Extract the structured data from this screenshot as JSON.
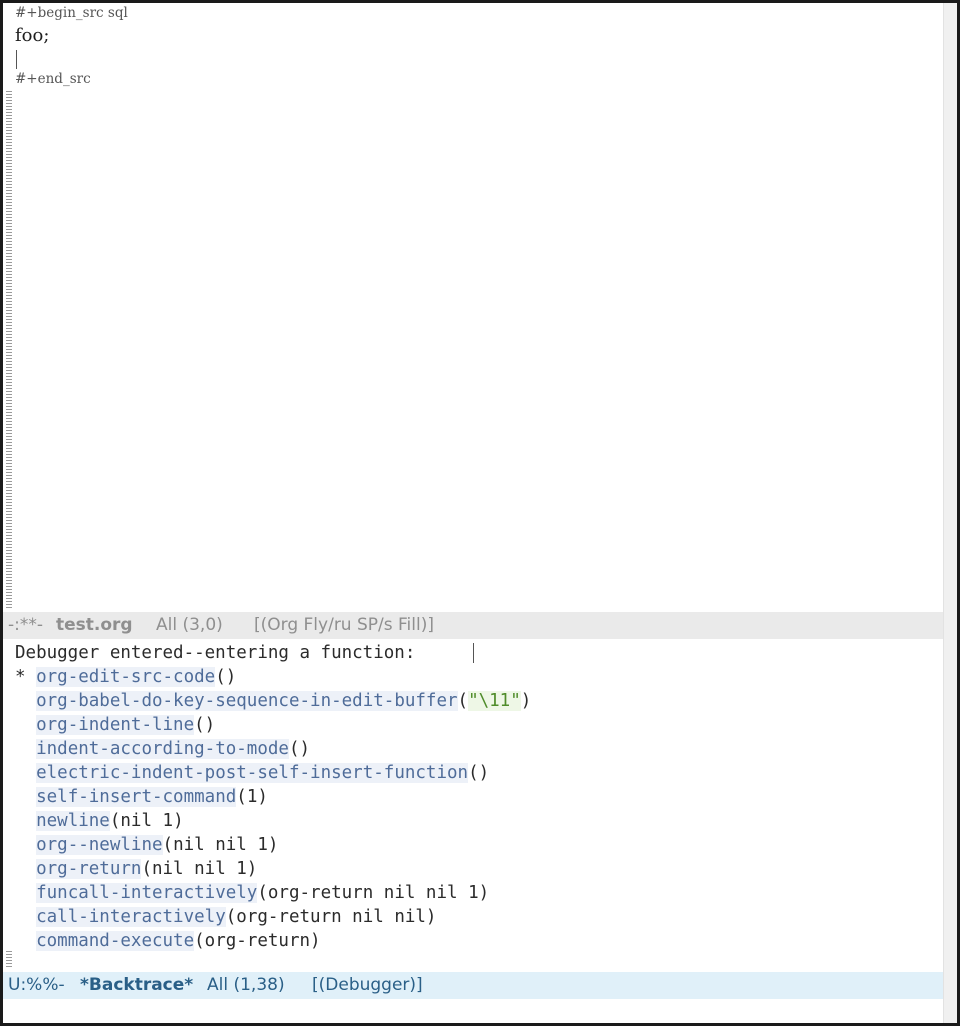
{
  "src_buffer": {
    "begin_line": "#+begin_src sql",
    "code_line": "foo;",
    "end_line": "#+end_src"
  },
  "modeline_top": {
    "status": "-:**-",
    "buffer": "test.org",
    "position": "All (3,0)",
    "modes": "[(Org Fly/ru SP/s Fill)]"
  },
  "debugger": {
    "header": "Debugger entered--entering a function:",
    "frames": [
      {
        "marker": "*",
        "fn": "org-edit-src-code",
        "args_pre": "()",
        "str": "",
        "args_post": ""
      },
      {
        "marker": " ",
        "fn": "org-babel-do-key-sequence-in-edit-buffer",
        "args_pre": "(",
        "str": "\"\\11\"",
        "args_post": ")"
      },
      {
        "marker": " ",
        "fn": "org-indent-line",
        "args_pre": "()",
        "str": "",
        "args_post": ""
      },
      {
        "marker": " ",
        "fn": "indent-according-to-mode",
        "args_pre": "()",
        "str": "",
        "args_post": ""
      },
      {
        "marker": " ",
        "fn": "electric-indent-post-self-insert-function",
        "args_pre": "()",
        "str": "",
        "args_post": ""
      },
      {
        "marker": " ",
        "fn": "self-insert-command",
        "args_pre": "(1)",
        "str": "",
        "args_post": ""
      },
      {
        "marker": " ",
        "fn": "newline",
        "args_pre": "(nil 1)",
        "str": "",
        "args_post": ""
      },
      {
        "marker": " ",
        "fn": "org--newline",
        "args_pre": "(nil nil 1)",
        "str": "",
        "args_post": ""
      },
      {
        "marker": " ",
        "fn": "org-return",
        "args_pre": "(nil nil 1)",
        "str": "",
        "args_post": ""
      },
      {
        "marker": " ",
        "fn": "funcall-interactively",
        "args_pre": "(org-return nil nil 1)",
        "str": "",
        "args_post": ""
      },
      {
        "marker": " ",
        "fn": "call-interactively",
        "args_pre": "(org-return nil nil)",
        "str": "",
        "args_post": ""
      },
      {
        "marker": " ",
        "fn": "command-execute",
        "args_pre": "(org-return)",
        "str": "",
        "args_post": ""
      }
    ]
  },
  "modeline_bottom": {
    "status": "U:%%-",
    "buffer": "*Backtrace*",
    "position": "All (1,38)",
    "modes": "[(Debugger)]"
  },
  "colors": {
    "function_bg": "#edf1f8",
    "function_fg": "#4f6c99",
    "string_bg": "#eef7e6",
    "string_fg": "#4f8c2a",
    "active_modeline_bg": "#e0f0f9",
    "inactive_modeline_bg": "#eaeaea"
  }
}
